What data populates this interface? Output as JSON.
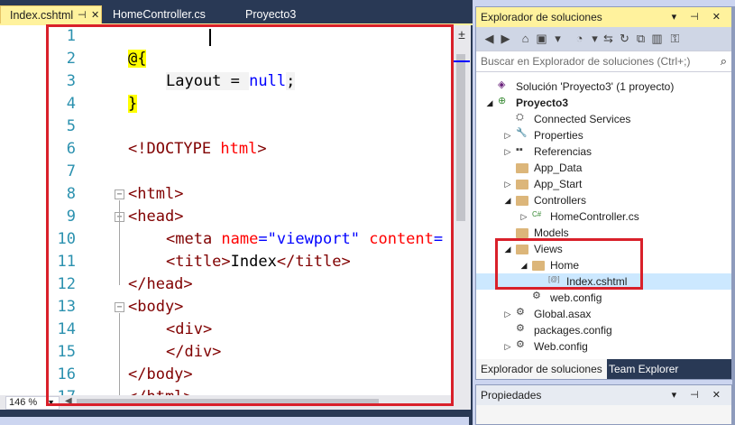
{
  "editor": {
    "tabs": [
      {
        "label": "Index.cshtml",
        "active": true,
        "pin": "⊣",
        "close": "✕"
      },
      {
        "label": "HomeController.cs",
        "active": false
      },
      {
        "label": "Proyecto3",
        "active": false
      }
    ],
    "zoom": "146 %",
    "split_icon": "±",
    "lines": [
      {
        "n": "1",
        "tokens": []
      },
      {
        "n": "2",
        "tokens": [
          {
            "t": "@{",
            "c": "t-razor"
          }
        ]
      },
      {
        "n": "3",
        "indent": 1,
        "tokens": [
          {
            "t": "Layout = ",
            "c": "t-razorblock"
          },
          {
            "t": "null",
            "c": "t-kw"
          },
          {
            "t": ";",
            "c": "t-razorblock"
          }
        ]
      },
      {
        "n": "4",
        "tokens": [
          {
            "t": "}",
            "c": "t-razor"
          }
        ]
      },
      {
        "n": "5",
        "tokens": []
      },
      {
        "n": "6",
        "tokens": [
          {
            "t": "<!DOCTYPE ",
            "c": "t-tag"
          },
          {
            "t": "html",
            "c": "t-attr"
          },
          {
            "t": ">",
            "c": "t-tag"
          }
        ]
      },
      {
        "n": "7",
        "tokens": []
      },
      {
        "n": "8",
        "fold": "−",
        "tokens": [
          {
            "t": "<",
            "c": "t-tag"
          },
          {
            "t": "html",
            "c": "t-tag"
          },
          {
            "t": ">",
            "c": "t-tag"
          }
        ]
      },
      {
        "n": "9",
        "fold": "−",
        "tokens": [
          {
            "t": "<",
            "c": "t-tag"
          },
          {
            "t": "head",
            "c": "t-tag"
          },
          {
            "t": ">",
            "c": "t-tag"
          }
        ]
      },
      {
        "n": "10",
        "indent": 1,
        "tokens": [
          {
            "t": "<meta ",
            "c": "t-tag"
          },
          {
            "t": "name",
            "c": "t-attr"
          },
          {
            "t": "=",
            "c": "t-str"
          },
          {
            "t": "\"viewport\"",
            "c": "t-str"
          },
          {
            "t": " ",
            "c": "t-plain"
          },
          {
            "t": "content",
            "c": "t-attr"
          },
          {
            "t": "=",
            "c": "t-str"
          }
        ]
      },
      {
        "n": "11",
        "indent": 1,
        "tokens": [
          {
            "t": "<title>",
            "c": "t-tag"
          },
          {
            "t": "Index",
            "c": "t-plain"
          },
          {
            "t": "</title>",
            "c": "t-tag"
          }
        ]
      },
      {
        "n": "12",
        "tokens": [
          {
            "t": "</head>",
            "c": "t-tag"
          }
        ]
      },
      {
        "n": "13",
        "fold": "−",
        "tokens": [
          {
            "t": "<body>",
            "c": "t-tag"
          }
        ]
      },
      {
        "n": "14",
        "indent": 1,
        "tokens": [
          {
            "t": "<div>",
            "c": "t-tag"
          }
        ]
      },
      {
        "n": "15",
        "indent": 1,
        "tokens": [
          {
            "t": "</div>",
            "c": "t-tag"
          }
        ]
      },
      {
        "n": "16",
        "tokens": [
          {
            "t": "</body>",
            "c": "t-tag"
          }
        ]
      },
      {
        "n": "17",
        "tokens": [
          {
            "t": "</html>",
            "c": "t-tag"
          }
        ]
      }
    ]
  },
  "solution_explorer": {
    "title": "Explorador de soluciones",
    "title_buttons": "▾ ⊣ ✕",
    "search_placeholder": "Buscar en Explorador de soluciones (Ctrl+;)",
    "search_icon": "⌕",
    "toolbar": [
      "◀",
      "▶",
      "⌂",
      "▣",
      "▾",
      "◔",
      "▾",
      "⇆",
      "↻",
      "⧉",
      "▥",
      "⚿"
    ],
    "tree": [
      {
        "label": "Solución 'Proyecto3'  (1 proyecto)",
        "level": 0,
        "expander": "",
        "icon": "solution-icon"
      },
      {
        "label": "Proyecto3",
        "level": 0,
        "expander": "◢",
        "icon": "web-project-icon",
        "bold": true
      },
      {
        "label": "Connected Services",
        "level": 1,
        "expander": "",
        "icon": "connected-services-icon"
      },
      {
        "label": "Properties",
        "level": 1,
        "expander": "▷",
        "icon": "wrench-icon"
      },
      {
        "label": "Referencias",
        "level": 1,
        "expander": "▷",
        "icon": "references-icon"
      },
      {
        "label": "App_Data",
        "level": 1,
        "expander": "",
        "icon": "folder-icon"
      },
      {
        "label": "App_Start",
        "level": 1,
        "expander": "▷",
        "icon": "folder-icon"
      },
      {
        "label": "Controllers",
        "level": 1,
        "expander": "◢",
        "icon": "folder-icon"
      },
      {
        "label": "HomeController.cs",
        "level": 2,
        "expander": "▷",
        "icon": "csharp-icon"
      },
      {
        "label": "Models",
        "level": 1,
        "expander": "",
        "icon": "folder-icon"
      },
      {
        "label": "Views",
        "level": 1,
        "expander": "◢",
        "icon": "folder-icon"
      },
      {
        "label": "Home",
        "level": 2,
        "expander": "◢",
        "icon": "folder-icon"
      },
      {
        "label": "Index.cshtml",
        "level": 3,
        "expander": "",
        "icon": "cshtml-icon",
        "selected": true
      },
      {
        "label": "web.config",
        "level": 2,
        "expander": "",
        "icon": "config-icon"
      },
      {
        "label": "Global.asax",
        "level": 1,
        "expander": "▷",
        "icon": "global-asax-icon"
      },
      {
        "label": "packages.config",
        "level": 1,
        "expander": "",
        "icon": "config-icon"
      },
      {
        "label": "Web.config",
        "level": 1,
        "expander": "▷",
        "icon": "config-icon"
      }
    ],
    "tabs": [
      {
        "label": "Explorador de soluciones",
        "active": true
      },
      {
        "label": "Team Explorer",
        "active": false
      }
    ]
  },
  "properties": {
    "title": "Propiedades",
    "title_buttons": "▾ ⊣ ✕"
  },
  "colors": {
    "chrome": "#293955",
    "active_tab": "#FFF29D",
    "highlight_red": "#D9202A",
    "selection": "#CCE8FF"
  }
}
